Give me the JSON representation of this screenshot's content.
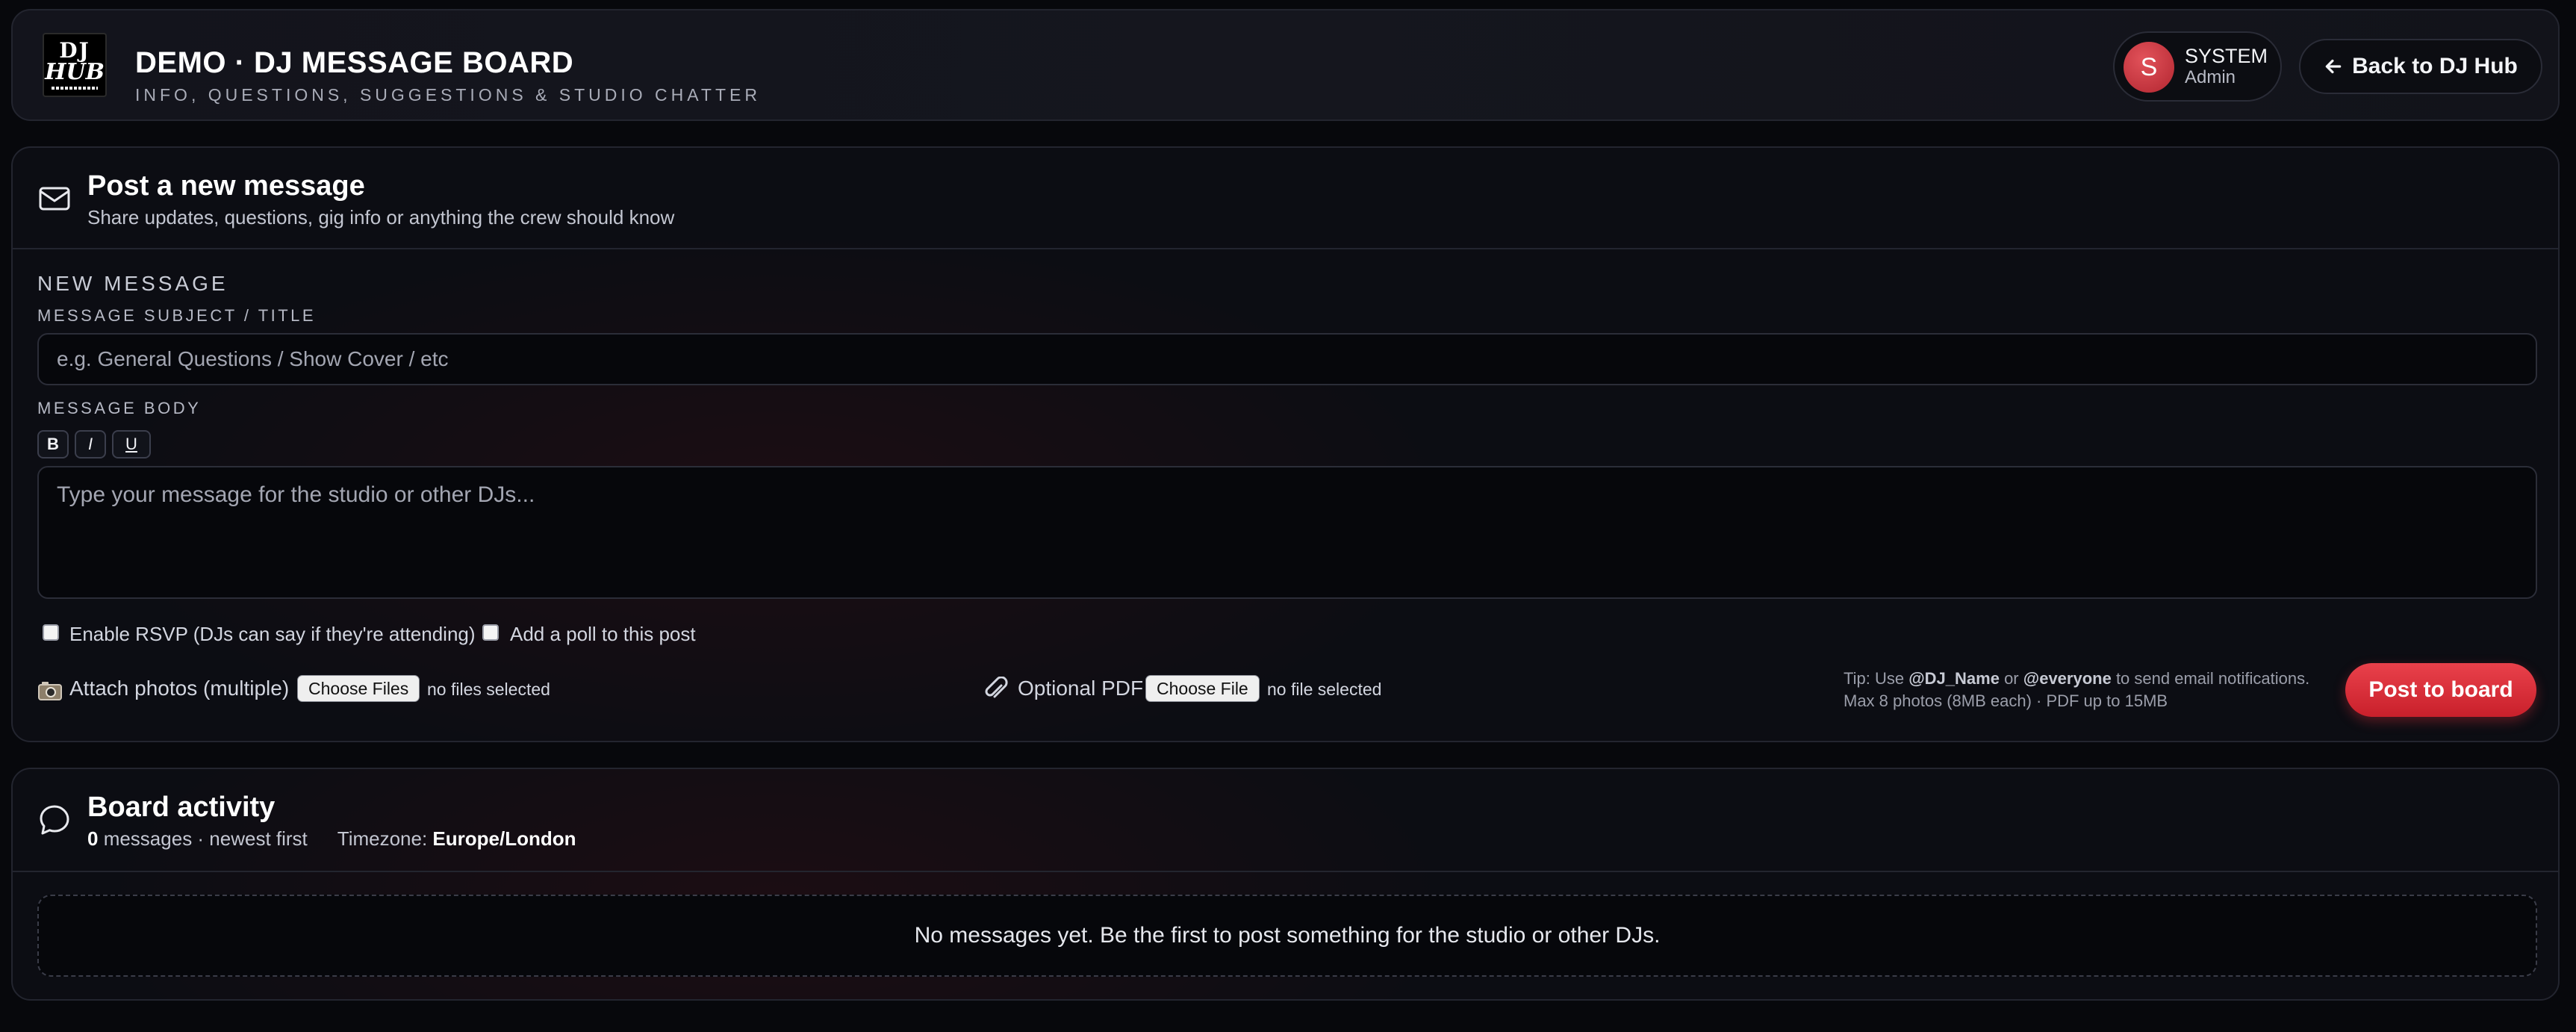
{
  "header": {
    "logo_line1": "DJ",
    "logo_line2": "HUB",
    "title": "DEMO · DJ MESSAGE BOARD",
    "subtitle": "INFO, QUESTIONS, SUGGESTIONS & STUDIO CHATTER",
    "user": {
      "initial": "S",
      "name": "SYSTEM",
      "role": "Admin"
    },
    "back_label": "Back to DJ Hub",
    "icons": {
      "back": "arrow-left-icon"
    }
  },
  "compose": {
    "title": "Post a new message",
    "subtitle": "Share updates, questions, gig info or anything the crew should know",
    "icon": "envelope-icon",
    "section_label": "NEW MESSAGE",
    "subject_label": "MESSAGE SUBJECT / TITLE",
    "subject_placeholder": "e.g. General Questions / Show Cover / etc",
    "subject_value": "",
    "body_label": "MESSAGE BODY",
    "format_buttons": {
      "bold": "B",
      "italic": "I",
      "underline": "U"
    },
    "body_placeholder": "Type your message for the studio or other DJs...",
    "body_value": "",
    "rsvp_label": "Enable RSVP (DJs can say if they're attending)",
    "rsvp_checked": false,
    "poll_label": "Add a poll to this post",
    "poll_checked": false,
    "photos_label": "Attach photos (multiple)",
    "photos_icon": "camera-icon",
    "photos_button": "Choose Files",
    "photos_status": "no files selected",
    "pdf_label": "Optional PDF",
    "pdf_icon": "paperclip-icon",
    "pdf_button": "Choose File",
    "pdf_status": "no file selected",
    "tip_prefix": "Tip: Use ",
    "tip_mention": "@DJ_Name",
    "tip_or": " or ",
    "tip_everyone": "@everyone",
    "tip_suffix": " to send email notifications.",
    "tip_limits": "Max 8 photos (8MB each) · PDF up to 15MB",
    "post_button": "Post to board"
  },
  "activity": {
    "title": "Board activity",
    "icon": "chat-bubble-icon",
    "count": "0",
    "count_suffix": " messages · newest first",
    "timezone_label": "Timezone: ",
    "timezone": "Europe/London",
    "empty_text": "No messages yet. Be the first to post something for the studio or other DJs."
  },
  "colors": {
    "background": "#07080c",
    "panel_border": "#23252f",
    "accent_red": "#e03540",
    "avatar_red": "#c8323b"
  }
}
